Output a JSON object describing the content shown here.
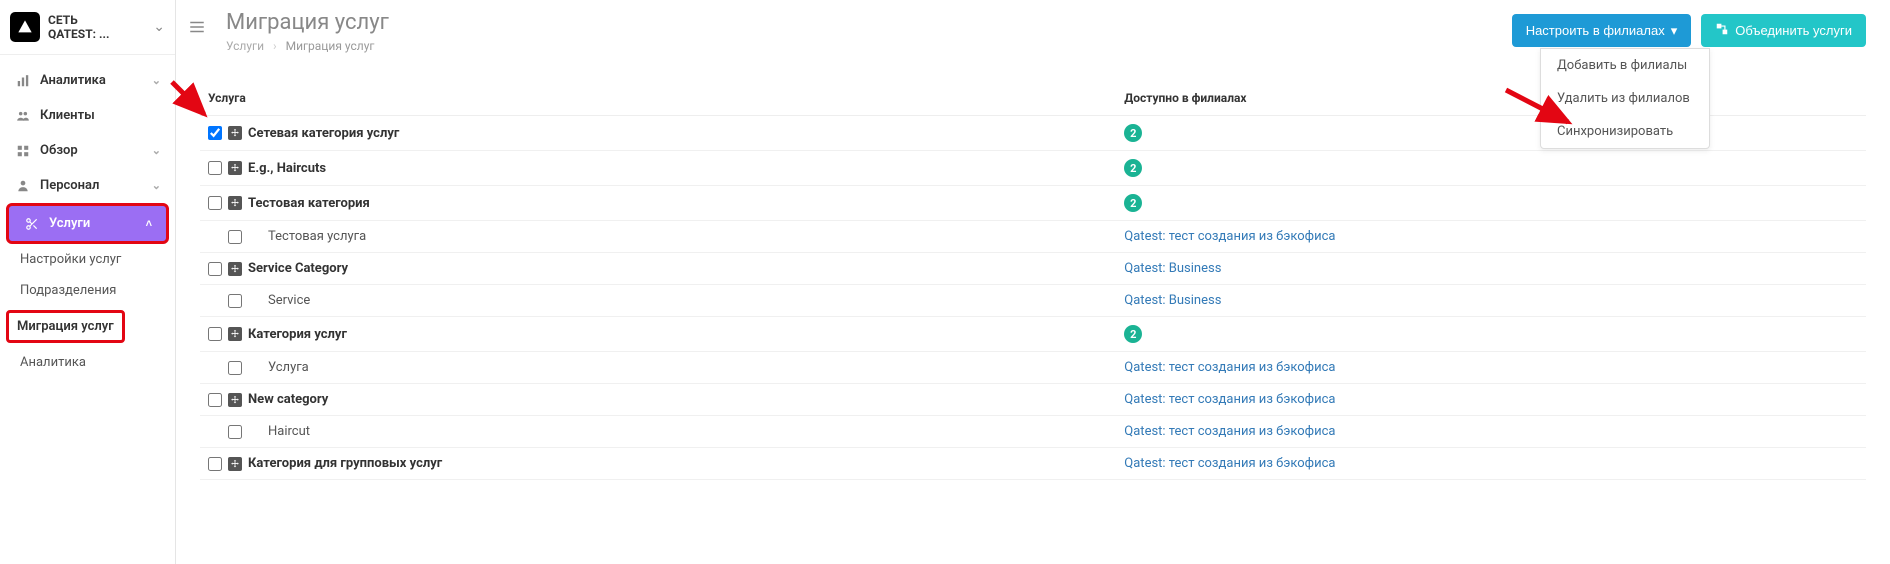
{
  "org": {
    "line1": "СЕТЬ",
    "line2": "QATEST: ..."
  },
  "sidebar": {
    "items": [
      {
        "label": "Аналитика",
        "icon": "bars-icon",
        "expandable": true
      },
      {
        "label": "Клиенты",
        "icon": "people-icon",
        "expandable": false
      },
      {
        "label": "Обзор",
        "icon": "grid-icon",
        "expandable": true
      },
      {
        "label": "Персонал",
        "icon": "person-icon",
        "expandable": true
      },
      {
        "label": "Услуги",
        "icon": "scissors-icon",
        "expandable": true,
        "active": true
      }
    ],
    "sub": [
      {
        "label": "Настройки услуг"
      },
      {
        "label": "Подразделения"
      },
      {
        "label": "Миграция услуг",
        "highlight": true
      },
      {
        "label": "Аналитика"
      }
    ]
  },
  "page": {
    "title": "Миграция услуг",
    "breadcrumb_root": "Услуги",
    "breadcrumb_current": "Миграция услуг"
  },
  "buttons": {
    "configure": "Настроить в филиалах",
    "merge": "Объединить услуги"
  },
  "dropdown": {
    "add": "Добавить в филиалы",
    "remove": "Удалить из филиалов",
    "sync": "Синхронизировать"
  },
  "table": {
    "col_service": "Услуга",
    "col_available": "Доступно в филиалах",
    "rows": [
      {
        "type": "cat",
        "name": "Сетевая категория услуг",
        "checked": true,
        "avail_badge": "2"
      },
      {
        "type": "cat",
        "name": "E.g., Haircuts",
        "checked": false,
        "avail_badge": "2"
      },
      {
        "type": "cat",
        "name": "Тестовая категория",
        "checked": false,
        "avail_badge": "2"
      },
      {
        "type": "svc",
        "name": "Тестовая услуга",
        "checked": false,
        "avail_text": "Qatest: тест создания из бэкофиса"
      },
      {
        "type": "cat",
        "name": "Service Category",
        "checked": false,
        "avail_text": "Qatest: Business"
      },
      {
        "type": "svc",
        "name": "Service",
        "checked": false,
        "avail_text": "Qatest: Business"
      },
      {
        "type": "cat",
        "name": "Категория услуг",
        "checked": false,
        "avail_badge": "2"
      },
      {
        "type": "svc",
        "name": "Услуга",
        "checked": false,
        "avail_text": "Qatest: тест создания из бэкофиса"
      },
      {
        "type": "cat",
        "name": "New category",
        "checked": false,
        "avail_text": "Qatest: тест создания из бэкофиса"
      },
      {
        "type": "svc",
        "name": "Haircut",
        "checked": false,
        "avail_text": "Qatest: тест создания из бэкофиса"
      },
      {
        "type": "cat",
        "name": "Категория для групповых услуг",
        "checked": false,
        "avail_text": "Qatest: тест создания из бэкофиса"
      }
    ]
  }
}
